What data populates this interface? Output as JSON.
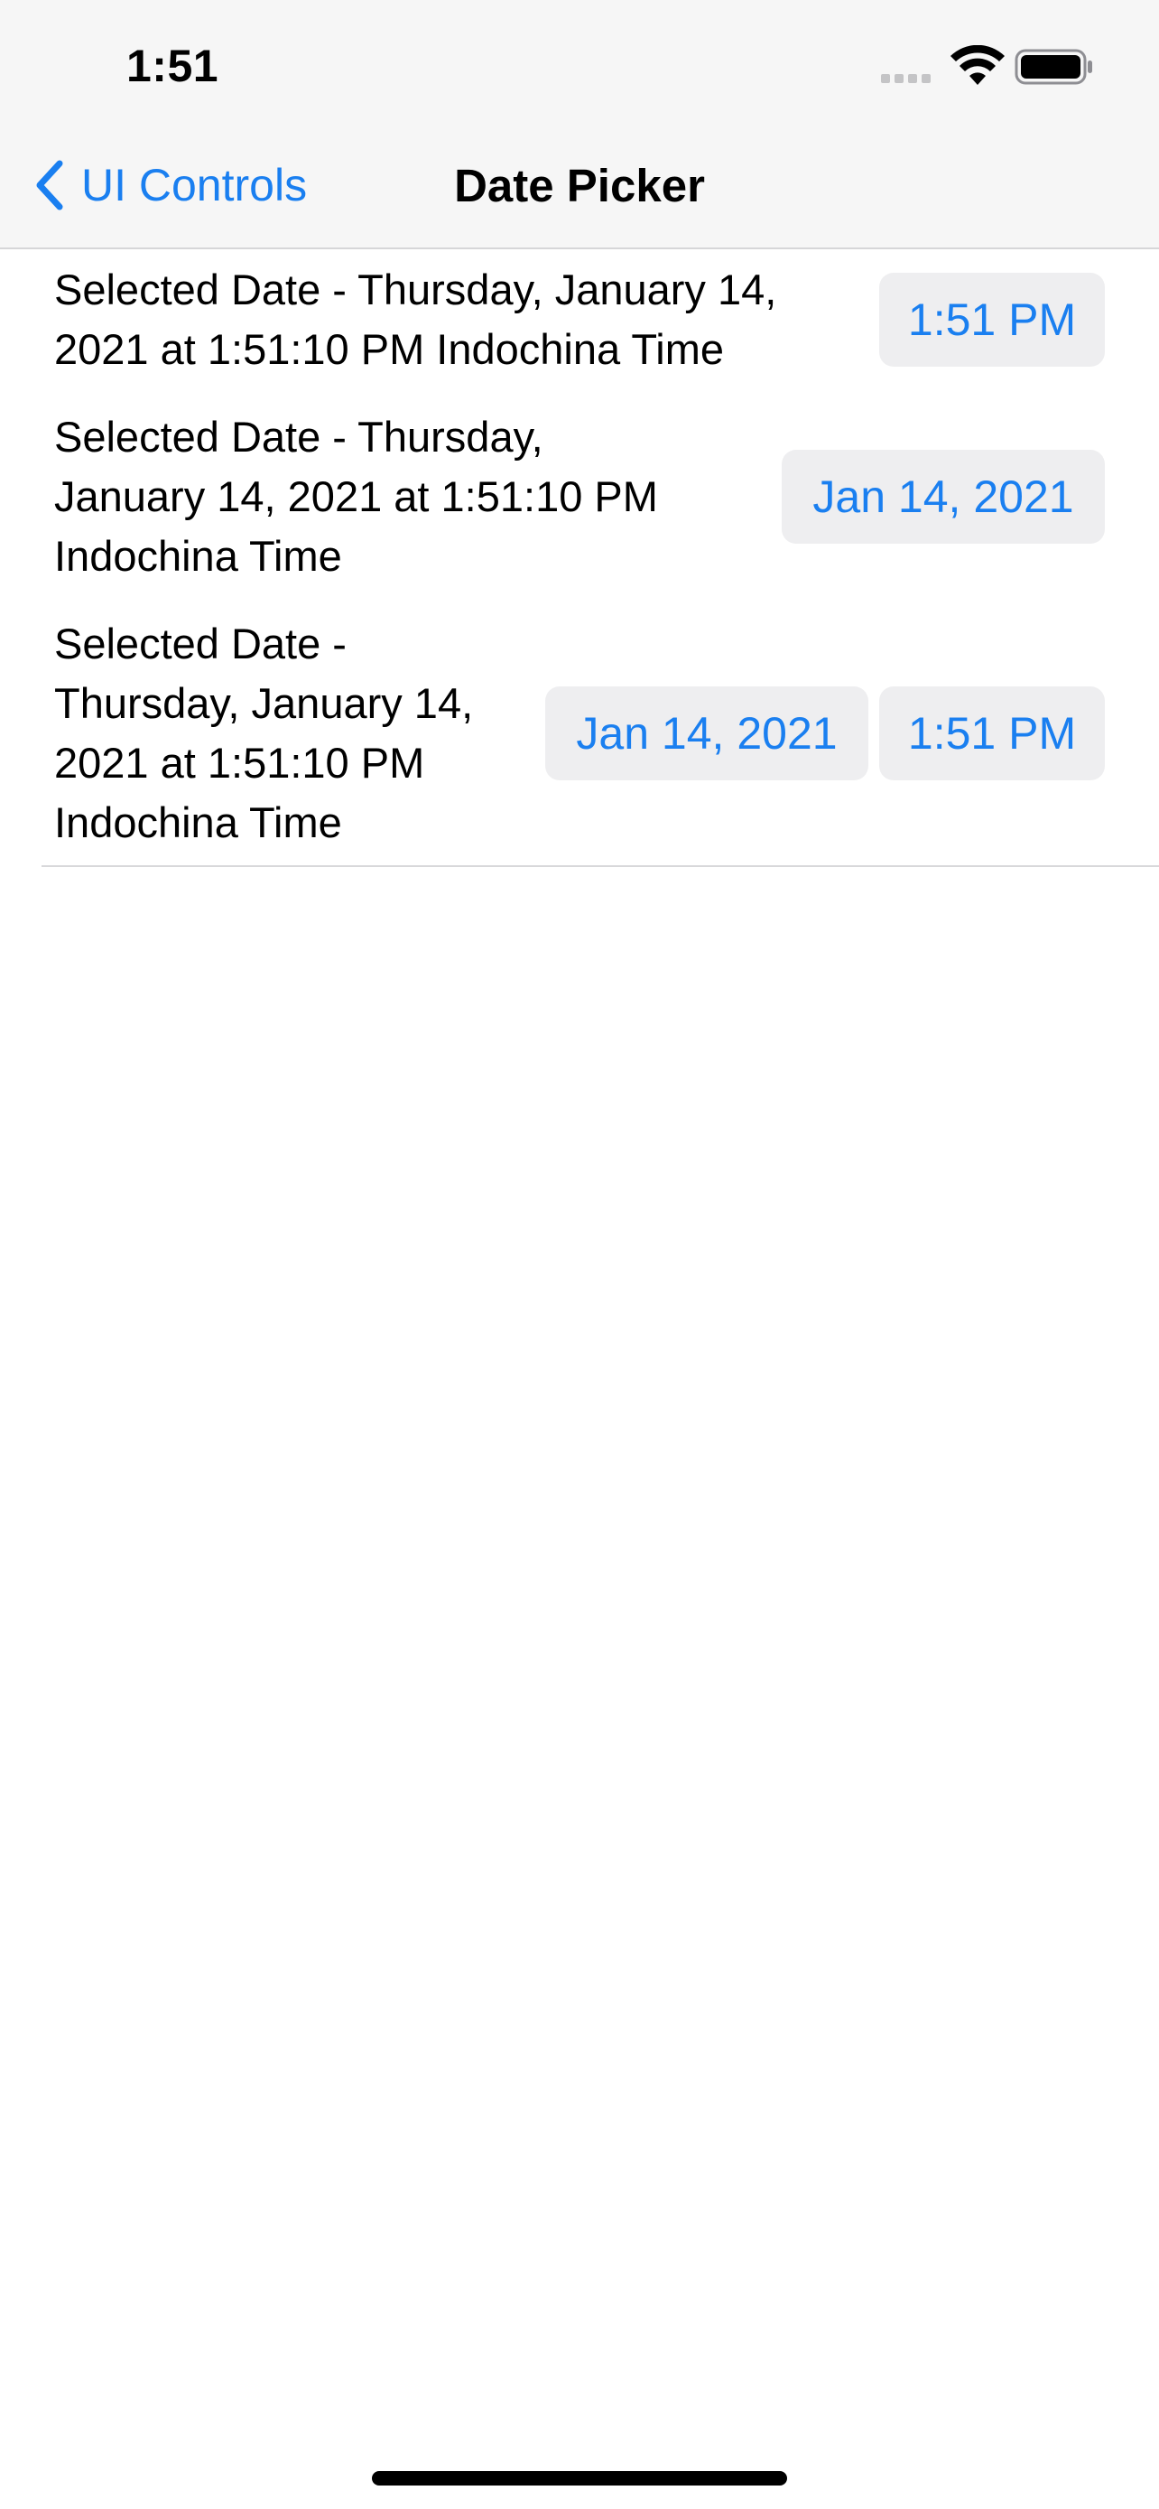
{
  "status_bar": {
    "time": "1:51"
  },
  "nav_bar": {
    "back_label": "UI Controls",
    "title": "Date Picker"
  },
  "rows": [
    {
      "text_lines": [
        "Selected Date - Thursday, January 14,",
        "2021 at 1:51:10 PM Indochina Time"
      ],
      "time_button": "1:51 PM"
    },
    {
      "text_lines": [
        "Selected Date - Thursday,",
        "January 14, 2021 at 1:51:10 PM",
        "Indochina Time"
      ],
      "date_button": "Jan 14, 2021"
    },
    {
      "text_lines": [
        "Selected Date -",
        "Thursday, January 14,",
        "2021 at 1:51:10 PM",
        "Indochina Time"
      ],
      "date_button": "Jan 14, 2021",
      "time_button": "1:51 PM"
    }
  ],
  "colors": {
    "accent": "#1a7ff0",
    "pill_background": "#eeeef0",
    "nav_background": "#f6f6f6"
  },
  "icons": [
    "wifi-icon",
    "battery-icon",
    "chevron-left-icon",
    "cellular-signal-icon"
  ]
}
